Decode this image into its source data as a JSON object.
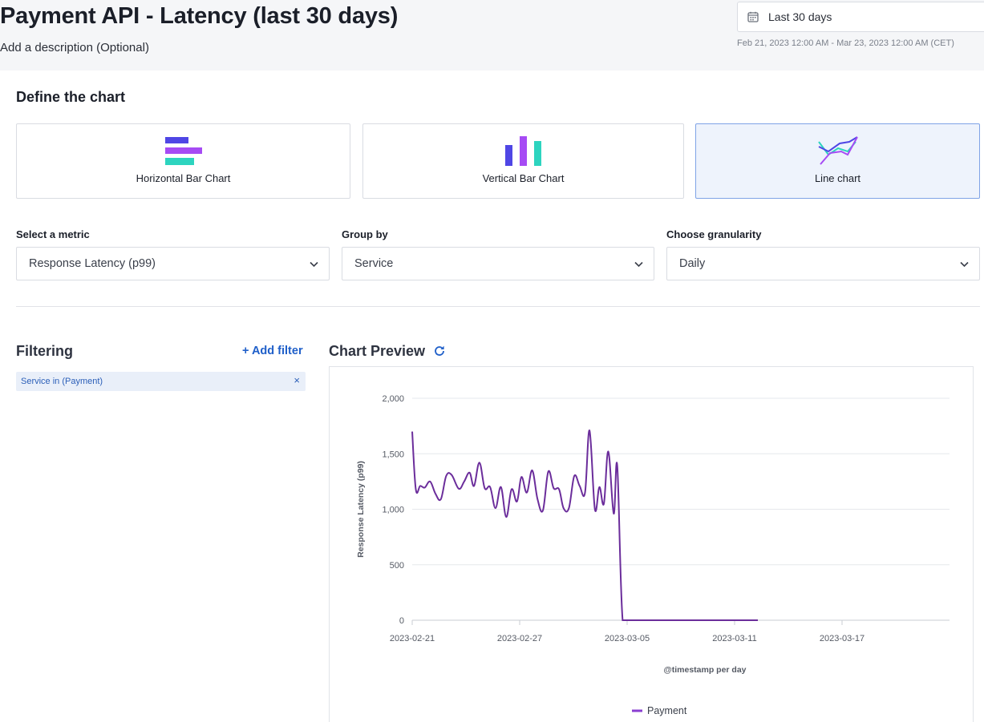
{
  "header": {
    "title": "Payment API - Latency (last 30 days)",
    "description_placeholder": "Add a description (Optional)",
    "date_picker": {
      "label": "Last 30 days",
      "icon": "calendar-icon"
    },
    "date_range": "Feb 21, 2023 12:00 AM - Mar 23, 2023 12:00 AM (CET)"
  },
  "define": {
    "title": "Define the chart",
    "chart_types": [
      {
        "label": "Horizontal Bar Chart",
        "icon": "horizontal-bar-chart-icon",
        "selected": false
      },
      {
        "label": "Vertical Bar Chart",
        "icon": "vertical-bar-chart-icon",
        "selected": false
      },
      {
        "label": "Line chart",
        "icon": "line-chart-icon",
        "selected": true
      }
    ],
    "metric": {
      "label": "Select a metric",
      "value": "Response Latency (p99)"
    },
    "group_by": {
      "label": "Group by",
      "value": "Service"
    },
    "granularity": {
      "label": "Choose granularity",
      "value": "Daily"
    }
  },
  "filtering": {
    "title": "Filtering",
    "add_label": "+ Add filter",
    "chips": [
      {
        "text": "Service in (Payment)",
        "remove_label": "×"
      }
    ]
  },
  "preview": {
    "title": "Chart Preview",
    "refresh_icon": "refresh-icon"
  },
  "colors": {
    "accent": "#1f5fc9",
    "series": "#6b2d9b",
    "legend_swatch": "#8a3fd1",
    "bar_blue": "#4f46e5",
    "bar_purple": "#a64bf4",
    "bar_teal": "#2dd4bf"
  },
  "chart_data": {
    "type": "line",
    "title": "",
    "xlabel": "@timestamp per day",
    "ylabel": "Response Latency (p99)",
    "ylim": [
      0,
      2000
    ],
    "yticks": [
      0,
      500,
      1000,
      1500,
      2000
    ],
    "ytick_labels": [
      "0",
      "500",
      "1,000",
      "1,500",
      "2,000"
    ],
    "xtick_labels": [
      "2023-02-21",
      "2023-02-27",
      "2023-03-05",
      "2023-03-11",
      "2023-03-17"
    ],
    "x": [
      "2023-02-21",
      "2023-02-22",
      "2023-02-23",
      "2023-02-24",
      "2023-02-25",
      "2023-02-26",
      "2023-02-27",
      "2023-02-28",
      "2023-03-01",
      "2023-03-02",
      "2023-03-03",
      "2023-03-04",
      "2023-03-05",
      "2023-03-06",
      "2023-03-07",
      "2023-03-08",
      "2023-03-09",
      "2023-03-10",
      "2023-03-11",
      "2023-03-12",
      "2023-03-13",
      "2023-03-14",
      "2023-03-15",
      "2023-03-16",
      "2023-03-17",
      "2023-03-18",
      "2023-03-19",
      "2023-03-20",
      "2023-03-21",
      "2023-03-22",
      "2023-03-23"
    ],
    "grid": true,
    "legend_position": "bottom",
    "series": [
      {
        "name": "Payment",
        "values": [
          1700,
          1180,
          1250,
          1100,
          1310,
          1200,
          1400,
          1200,
          1010,
          1180,
          1150,
          1340,
          1010,
          1350,
          1200,
          1000,
          1290,
          1160,
          1700,
          1000,
          1520,
          960,
          0,
          0,
          0,
          0,
          0,
          0,
          0,
          0,
          0
        ],
        "dense_values": [
          [
            0,
            1700
          ],
          [
            0.2,
            1180
          ],
          [
            0.45,
            1210
          ],
          [
            0.7,
            1195
          ],
          [
            1.0,
            1250
          ],
          [
            1.3,
            1140
          ],
          [
            1.6,
            1090
          ],
          [
            1.9,
            1300
          ],
          [
            2.2,
            1310
          ],
          [
            2.6,
            1185
          ],
          [
            2.9,
            1250
          ],
          [
            3.2,
            1330
          ],
          [
            3.45,
            1210
          ],
          [
            3.75,
            1420
          ],
          [
            4.05,
            1190
          ],
          [
            4.35,
            1200
          ],
          [
            4.65,
            1010
          ],
          [
            4.95,
            1200
          ],
          [
            5.25,
            930
          ],
          [
            5.55,
            1180
          ],
          [
            5.85,
            1070
          ],
          [
            6.1,
            1290
          ],
          [
            6.4,
            1150
          ],
          [
            6.7,
            1350
          ],
          [
            7.0,
            1090
          ],
          [
            7.3,
            990
          ],
          [
            7.6,
            1340
          ],
          [
            7.9,
            1190
          ],
          [
            8.2,
            1180
          ],
          [
            8.45,
            1010
          ],
          [
            8.75,
            1010
          ],
          [
            9.05,
            1300
          ],
          [
            9.35,
            1210
          ],
          [
            9.65,
            1150
          ],
          [
            9.9,
            1710
          ],
          [
            10.2,
            1000
          ],
          [
            10.45,
            1200
          ],
          [
            10.7,
            1050
          ],
          [
            10.95,
            1520
          ],
          [
            11.25,
            960
          ],
          [
            11.45,
            1390
          ],
          [
            11.75,
            0
          ],
          [
            12.2,
            0
          ],
          [
            15,
            0
          ],
          [
            19.3,
            0
          ]
        ]
      }
    ]
  }
}
